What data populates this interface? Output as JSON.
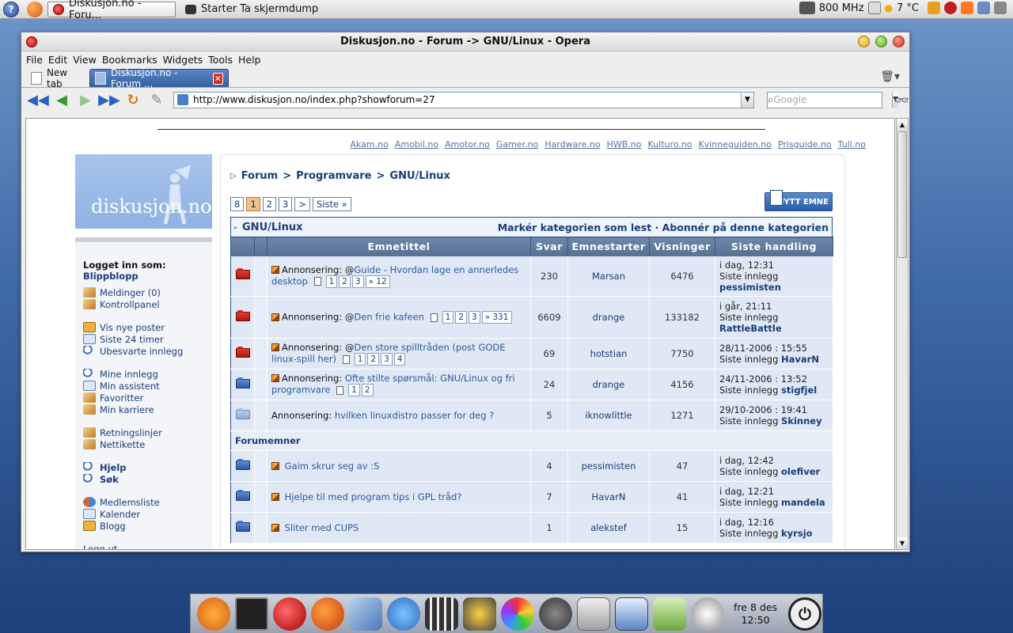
{
  "top_panel": {
    "tasks": [
      {
        "label": "Diskusjon.no - Foru...",
        "active": true
      },
      {
        "label": "Starter Ta skjermdump",
        "active": false
      }
    ],
    "cpu": "800 MHz",
    "temp": "7 °C"
  },
  "window": {
    "title": "Diskusjon.no - Forum -> GNU/Linux - Opera",
    "menu": [
      "File",
      "Edit",
      "View",
      "Bookmarks",
      "Widgets",
      "Tools",
      "Help"
    ],
    "tabs": {
      "new_tab": "New tab",
      "active_tab": "Diskusjon.no - Forum ..."
    },
    "address": "http://www.diskusjon.no/index.php?showforum=27",
    "search_placeholder": "Google"
  },
  "page": {
    "sister_links": [
      "Akam.no",
      "Amobil.no",
      "Amotor.no",
      "Gamer.no",
      "Hardware.no",
      "HWB.no",
      "Kulturo.no",
      "Kvinneguiden.no",
      "Prisguide.no",
      "Tull.no"
    ],
    "logo_text": "diskusjon.no",
    "sidebar": {
      "logged_in_label": "Logget inn som:",
      "username": "Blippblopp",
      "groups": [
        [
          {
            "label": "Meldinger (0)",
            "icon": "pencil"
          },
          {
            "label": "Kontrollpanel",
            "icon": "pencil"
          }
        ],
        [
          {
            "label": "Vis nye poster",
            "icon": "mail"
          },
          {
            "label": "Siste 24 timer",
            "icon": "cal"
          },
          {
            "label": "Ubesvarte innlegg",
            "icon": "mag"
          }
        ],
        [
          {
            "label": "Mine innlegg",
            "icon": "mag"
          },
          {
            "label": "Min assistent",
            "icon": "cal"
          },
          {
            "label": "Favoritter",
            "icon": "pencil"
          },
          {
            "label": "Min karriere",
            "icon": "pencil"
          }
        ],
        [
          {
            "label": "Retningslinjer",
            "icon": "pencil"
          },
          {
            "label": "Nettikette",
            "icon": "pencil"
          }
        ],
        [
          {
            "label": "Hjelp",
            "icon": "mag",
            "bold": true
          },
          {
            "label": "Søk",
            "icon": "mag",
            "bold": true
          }
        ],
        [
          {
            "label": "Medlemsliste",
            "icon": "people"
          },
          {
            "label": "Kalender",
            "icon": "cal"
          },
          {
            "label": "Blogg",
            "icon": "mail"
          }
        ]
      ],
      "logout": "Logg ut"
    },
    "breadcrumb": [
      "Forum",
      "Programvare",
      "GNU/Linux"
    ],
    "pagination": [
      "8",
      "1",
      "2",
      "3",
      ">",
      "Siste »"
    ],
    "current_page": "1",
    "new_topic_label": "NYTT EMNE",
    "category": {
      "name": "GNU/Linux",
      "actions": "Markér kategorien som lest · Abonnér på denne kategorien"
    },
    "columns": [
      "Emnetittel",
      "Svar",
      "Emnestarter",
      "Visninger",
      "Siste handling"
    ],
    "announcements": [
      {
        "folder": "red",
        "prefix": "Annonsering:",
        "title": "Guide - Hvordan lage en annerledes desktop",
        "pages": [
          "1",
          "2",
          "3",
          "» 12"
        ],
        "replies": "230",
        "starter": "Marsan",
        "views": "6476",
        "last_time": "i dag, 12:31",
        "last_label": "Siste innlegg",
        "last_user": "pessimisten"
      },
      {
        "folder": "red",
        "prefix": "Annonsering:",
        "title": "Den frie kafeen",
        "pages": [
          "1",
          "2",
          "3",
          "» 331"
        ],
        "replies": "6609",
        "starter": "drange",
        "views": "133182",
        "last_time": "i går, 21:11",
        "last_label": "Siste innlegg",
        "last_user": "RattleBattle"
      },
      {
        "folder": "red",
        "prefix": "Annonsering:",
        "title": "Den store spilltråden (post GODE linux-spill her)",
        "pages": [
          "1",
          "2",
          "3",
          "4"
        ],
        "replies": "69",
        "starter": "hotstian",
        "views": "7750",
        "last_time": "28/11-2006 : 15:55",
        "last_label": "Siste innlegg",
        "last_user": "HavarN"
      },
      {
        "folder": "blue",
        "prefix": "Annonsering:",
        "title": "Ofte stilte spørsmål: GNU/Linux og fri programvare",
        "pages": [
          "1",
          "2"
        ],
        "replies": "24",
        "starter": "drange",
        "views": "4156",
        "last_time": "24/11-2006 : 13:52",
        "last_label": "Siste innlegg",
        "last_user": "stigfjel"
      },
      {
        "folder": "light",
        "prefix": "Annonsering:",
        "title": "hvilken linuxdistro passer for deg ?",
        "pages": [],
        "replies": "5",
        "starter": "iknowlittle",
        "views": "1271",
        "last_time": "29/10-2006 : 19:41",
        "last_label": "Siste innlegg",
        "last_user": "Skinney"
      }
    ],
    "forum_topics_label": "Forumemner",
    "topics": [
      {
        "folder": "blue",
        "title": "Gaim skrur seg av :S",
        "replies": "4",
        "starter": "pessimisten",
        "views": "47",
        "last_time": "i dag, 12:42",
        "last_label": "Siste innlegg",
        "last_user": "olefiver"
      },
      {
        "folder": "blue",
        "title": "Hjelpe til med program tips i GPL tråd?",
        "replies": "7",
        "starter": "HavarN",
        "views": "41",
        "last_time": "i dag, 12:21",
        "last_label": "Siste innlegg",
        "last_user": "mandela"
      },
      {
        "folder": "blue",
        "title": "Sliter med CUPS",
        "replies": "1",
        "starter": "alekstef",
        "views": "15",
        "last_time": "i dag, 12:16",
        "last_label": "Siste innlegg",
        "last_user": "kyrsjo"
      }
    ]
  },
  "dock": {
    "day": "fre",
    "date": "8 des",
    "time": "12:50"
  }
}
